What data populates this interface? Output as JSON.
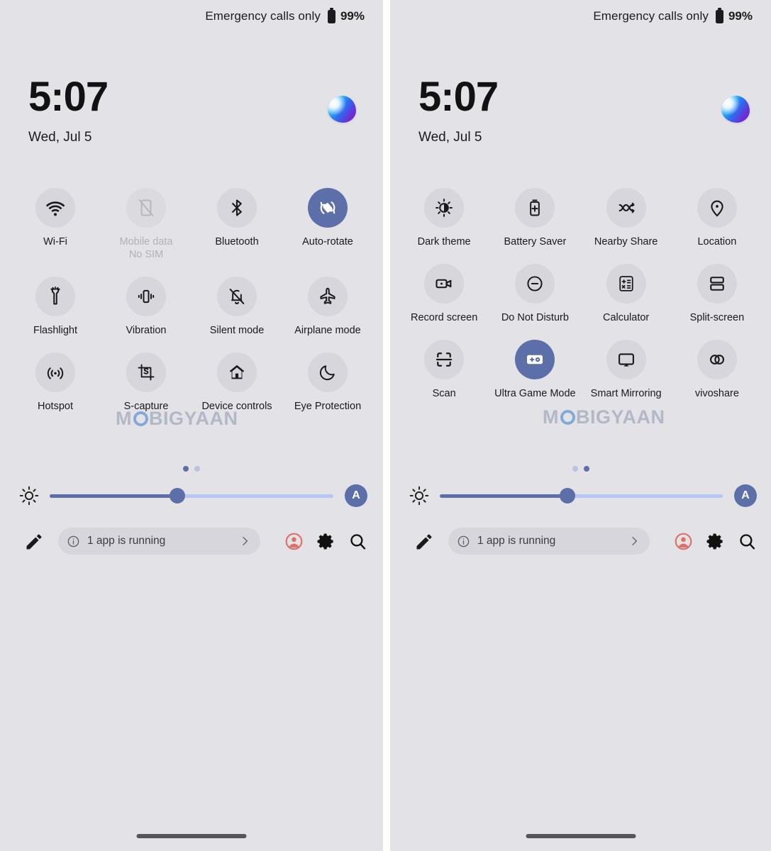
{
  "colors": {
    "panel_bg": "#e3e2e7",
    "tile_bg": "#d7d6dc",
    "tile_active_bg": "#5d6fa8",
    "accent": "#5d6fa8",
    "slider_track": "#b6c6f5",
    "profile_icon": "#dd7168",
    "text": "#1a1a1c",
    "text_disabled": "#b2b1b7"
  },
  "watermark": {
    "before": "M",
    "o": "O",
    "after": "BIGYAAN"
  },
  "panels": [
    {
      "id": "quick-settings-page-1",
      "status": {
        "carrier": "Emergency calls only",
        "battery": "99%",
        "battery_icon": "battery-icon"
      },
      "clock": {
        "time": "5:07",
        "date": "Wed, Jul 5"
      },
      "orb_icon": "assistant-orb-icon",
      "tiles": [
        {
          "label": "Wi-Fi",
          "sub": "",
          "icon": "wifi-icon",
          "state": "on"
        },
        {
          "label": "Mobile data",
          "sub": "No SIM",
          "icon": "mobile-data-off-icon",
          "state": "disabled"
        },
        {
          "label": "Bluetooth",
          "sub": "",
          "icon": "bluetooth-icon",
          "state": "on"
        },
        {
          "label": "Auto-rotate",
          "sub": "",
          "icon": "auto-rotate-icon",
          "state": "active"
        },
        {
          "label": "Flashlight",
          "sub": "",
          "icon": "flashlight-icon",
          "state": "on"
        },
        {
          "label": "Vibration",
          "sub": "",
          "icon": "vibration-icon",
          "state": "on"
        },
        {
          "label": "Silent mode",
          "sub": "",
          "icon": "bell-off-icon",
          "state": "on"
        },
        {
          "label": "Airplane mode",
          "sub": "",
          "icon": "airplane-icon",
          "state": "on"
        },
        {
          "label": "Hotspot",
          "sub": "",
          "icon": "hotspot-icon",
          "state": "on"
        },
        {
          "label": "S-capture",
          "sub": "",
          "icon": "s-capture-icon",
          "state": "on"
        },
        {
          "label": "Device controls",
          "sub": "",
          "icon": "home-icon",
          "state": "on"
        },
        {
          "label": "Eye Protection",
          "sub": "",
          "icon": "moon-icon",
          "state": "on"
        }
      ],
      "pager": {
        "count": 2,
        "active_index": 0
      },
      "brightness": {
        "icon": "brightness-icon",
        "value_percent": 45,
        "auto_label": "A"
      },
      "footer": {
        "edit_icon": "pencil-icon",
        "running_info_icon": "info-icon",
        "running_text": "1 app is running",
        "running_chevron_icon": "chevron-right-icon",
        "profile_icon": "user-profile-icon",
        "settings_icon": "gear-icon",
        "search_icon": "search-icon"
      }
    },
    {
      "id": "quick-settings-page-2",
      "status": {
        "carrier": "Emergency calls only",
        "battery": "99%",
        "battery_icon": "battery-icon"
      },
      "clock": {
        "time": "5:07",
        "date": "Wed, Jul 5"
      },
      "orb_icon": "assistant-orb-icon",
      "tiles": [
        {
          "label": "Dark theme",
          "sub": "",
          "icon": "dark-theme-icon",
          "state": "on"
        },
        {
          "label": "Battery Saver",
          "sub": "",
          "icon": "battery-saver-icon",
          "state": "on"
        },
        {
          "label": "Nearby Share",
          "sub": "",
          "icon": "nearby-share-icon",
          "state": "on"
        },
        {
          "label": "Location",
          "sub": "",
          "icon": "location-pin-icon",
          "state": "on"
        },
        {
          "label": "Record screen",
          "sub": "",
          "icon": "record-screen-icon",
          "state": "on"
        },
        {
          "label": "Do Not Disturb",
          "sub": "",
          "icon": "do-not-disturb-icon",
          "state": "on"
        },
        {
          "label": "Calculator",
          "sub": "",
          "icon": "calculator-icon",
          "state": "on"
        },
        {
          "label": "Split-screen",
          "sub": "",
          "icon": "split-screen-icon",
          "state": "on"
        },
        {
          "label": "Scan",
          "sub": "",
          "icon": "scan-icon",
          "state": "on"
        },
        {
          "label": "Ultra Game Mode",
          "sub": "",
          "icon": "game-controller-icon",
          "state": "active"
        },
        {
          "label": "Smart Mirroring",
          "sub": "",
          "icon": "cast-icon",
          "state": "on"
        },
        {
          "label": "vivoshare",
          "sub": "",
          "icon": "vivoshare-link-icon",
          "state": "on"
        }
      ],
      "pager": {
        "count": 2,
        "active_index": 1
      },
      "brightness": {
        "icon": "brightness-icon",
        "value_percent": 45,
        "auto_label": "A"
      },
      "footer": {
        "edit_icon": "pencil-icon",
        "running_info_icon": "info-icon",
        "running_text": "1 app is running",
        "running_chevron_icon": "chevron-right-icon",
        "profile_icon": "user-profile-icon",
        "settings_icon": "gear-icon",
        "search_icon": "search-icon"
      }
    }
  ]
}
